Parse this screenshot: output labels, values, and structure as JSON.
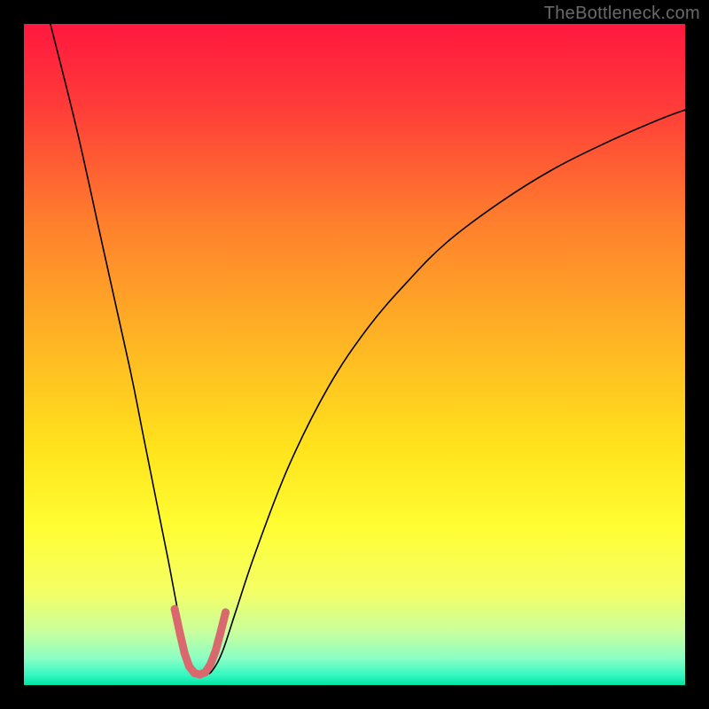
{
  "watermark": "TheBottleneck.com",
  "chart_data": {
    "type": "line",
    "title": "",
    "xlabel": "",
    "ylabel": "",
    "xlim": [
      0,
      100
    ],
    "ylim": [
      0,
      100
    ],
    "grid": false,
    "axes_visible": false,
    "background_gradient": [
      {
        "offset": 0.0,
        "color": "#ff183f"
      },
      {
        "offset": 0.12,
        "color": "#ff3a39"
      },
      {
        "offset": 0.3,
        "color": "#ff7f2d"
      },
      {
        "offset": 0.48,
        "color": "#ffb524"
      },
      {
        "offset": 0.64,
        "color": "#ffe31c"
      },
      {
        "offset": 0.76,
        "color": "#fffd33"
      },
      {
        "offset": 0.86,
        "color": "#f4ff66"
      },
      {
        "offset": 0.92,
        "color": "#c8ff9d"
      },
      {
        "offset": 0.96,
        "color": "#8affc4"
      },
      {
        "offset": 0.985,
        "color": "#34f7c0"
      },
      {
        "offset": 1.0,
        "color": "#00e5a4"
      }
    ],
    "series": [
      {
        "name": "bottleneck-curve",
        "color": "#000000",
        "width": 1.6,
        "type": "line",
        "x": [
          4.0,
          8.0,
          12.0,
          16.0,
          18.0,
          20.0,
          22.0,
          23.5,
          24.5,
          25.5,
          26.5,
          27.5,
          28.5,
          30.0,
          32.0,
          35.0,
          40.0,
          46.0,
          52.0,
          58.0,
          64.0,
          72.0,
          80.0,
          88.0,
          96.0,
          100.0
        ],
        "y": [
          100.0,
          84.0,
          66.0,
          48.0,
          38.0,
          28.0,
          18.0,
          10.0,
          5.0,
          2.2,
          1.6,
          1.6,
          2.2,
          5.0,
          11.0,
          20.0,
          33.0,
          45.0,
          54.0,
          61.0,
          67.0,
          73.0,
          78.0,
          82.0,
          85.5,
          87.0
        ]
      },
      {
        "name": "sweet-spot-band",
        "color": "#d9696e",
        "width": 9.0,
        "type": "line",
        "x": [
          22.8,
          23.6,
          24.3,
          25.0,
          25.8,
          26.6,
          27.4,
          28.2,
          29.0,
          29.7,
          30.5
        ],
        "y": [
          11.5,
          7.8,
          4.8,
          2.8,
          1.8,
          1.6,
          1.9,
          3.1,
          5.2,
          7.8,
          11.0
        ]
      }
    ]
  }
}
